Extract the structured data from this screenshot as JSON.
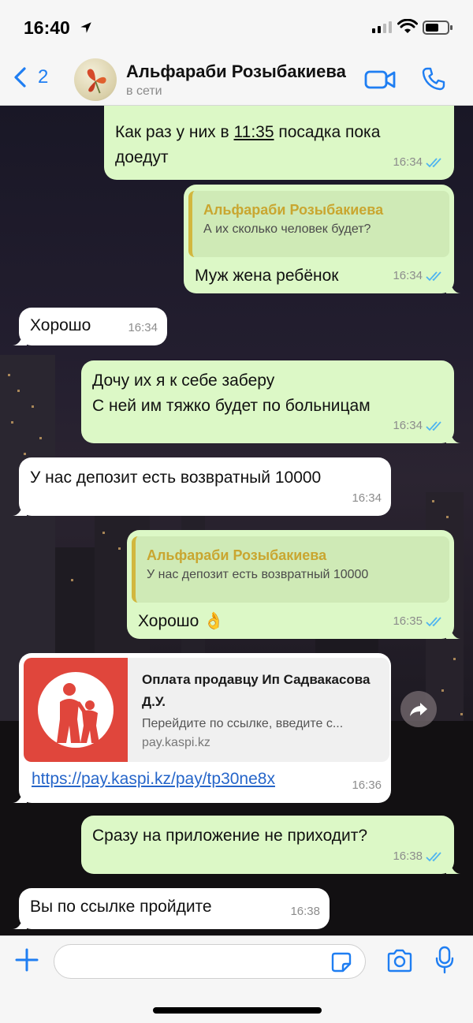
{
  "status_bar": {
    "time": "16:40"
  },
  "header": {
    "back_count": "2",
    "contact_name": "Альфараби Розыбакиева",
    "contact_status": "в сети"
  },
  "messages": [
    {
      "dir": "out",
      "text_before": "Как раз у них в ",
      "text_link": "11:35",
      "text_after": " посадка пока доедут",
      "time": "16:34"
    },
    {
      "dir": "out",
      "quote_name": "Альфараби Розыбакиева",
      "quote_text": "А их сколько человек будет?",
      "text": "Муж жена ребёнок",
      "time": "16:34"
    },
    {
      "dir": "in",
      "text": "Хорошо",
      "time": "16:34"
    },
    {
      "dir": "out",
      "line1": "Дочу их я к себе заберу",
      "line2": "С ней им тяжко будет по больницам",
      "time": "16:34"
    },
    {
      "dir": "in",
      "text": "У нас депозит есть возвратный 10000",
      "time": "16:34"
    },
    {
      "dir": "out",
      "quote_name": "Альфараби Розыбакиева",
      "quote_text": "У нас депозит есть возвратный 10000",
      "text": "Хорошо 👌",
      "time": "16:35"
    },
    {
      "dir": "in",
      "link_title": "Оплата продавцу Ип Садвакасова Д.У.",
      "link_desc": "Перейдите по ссылке, введите с...",
      "link_domain": "pay.kaspi.kz",
      "url": "https://pay.kaspi.kz/pay/tp30ne8x",
      "time": "16:36"
    },
    {
      "dir": "out",
      "text": "Сразу на приложение не приходит?",
      "time": "16:38"
    },
    {
      "dir": "in",
      "text": "Вы по ссылке пройдите",
      "time": "16:38"
    }
  ],
  "input_bar": {
    "value": ""
  },
  "colors": {
    "accent": "#1f7ef2",
    "outgoing_bubble": "#dcf8c6",
    "incoming_bubble": "#ffffff",
    "quote_name": "#c9a630",
    "kaspi_red": "#e0463c"
  },
  "icons": [
    "back-chevron-icon",
    "video-call-icon",
    "phone-icon",
    "forward-share-icon",
    "plus-icon",
    "sticker-icon",
    "camera-icon",
    "microphone-icon",
    "read-ticks-icon"
  ]
}
